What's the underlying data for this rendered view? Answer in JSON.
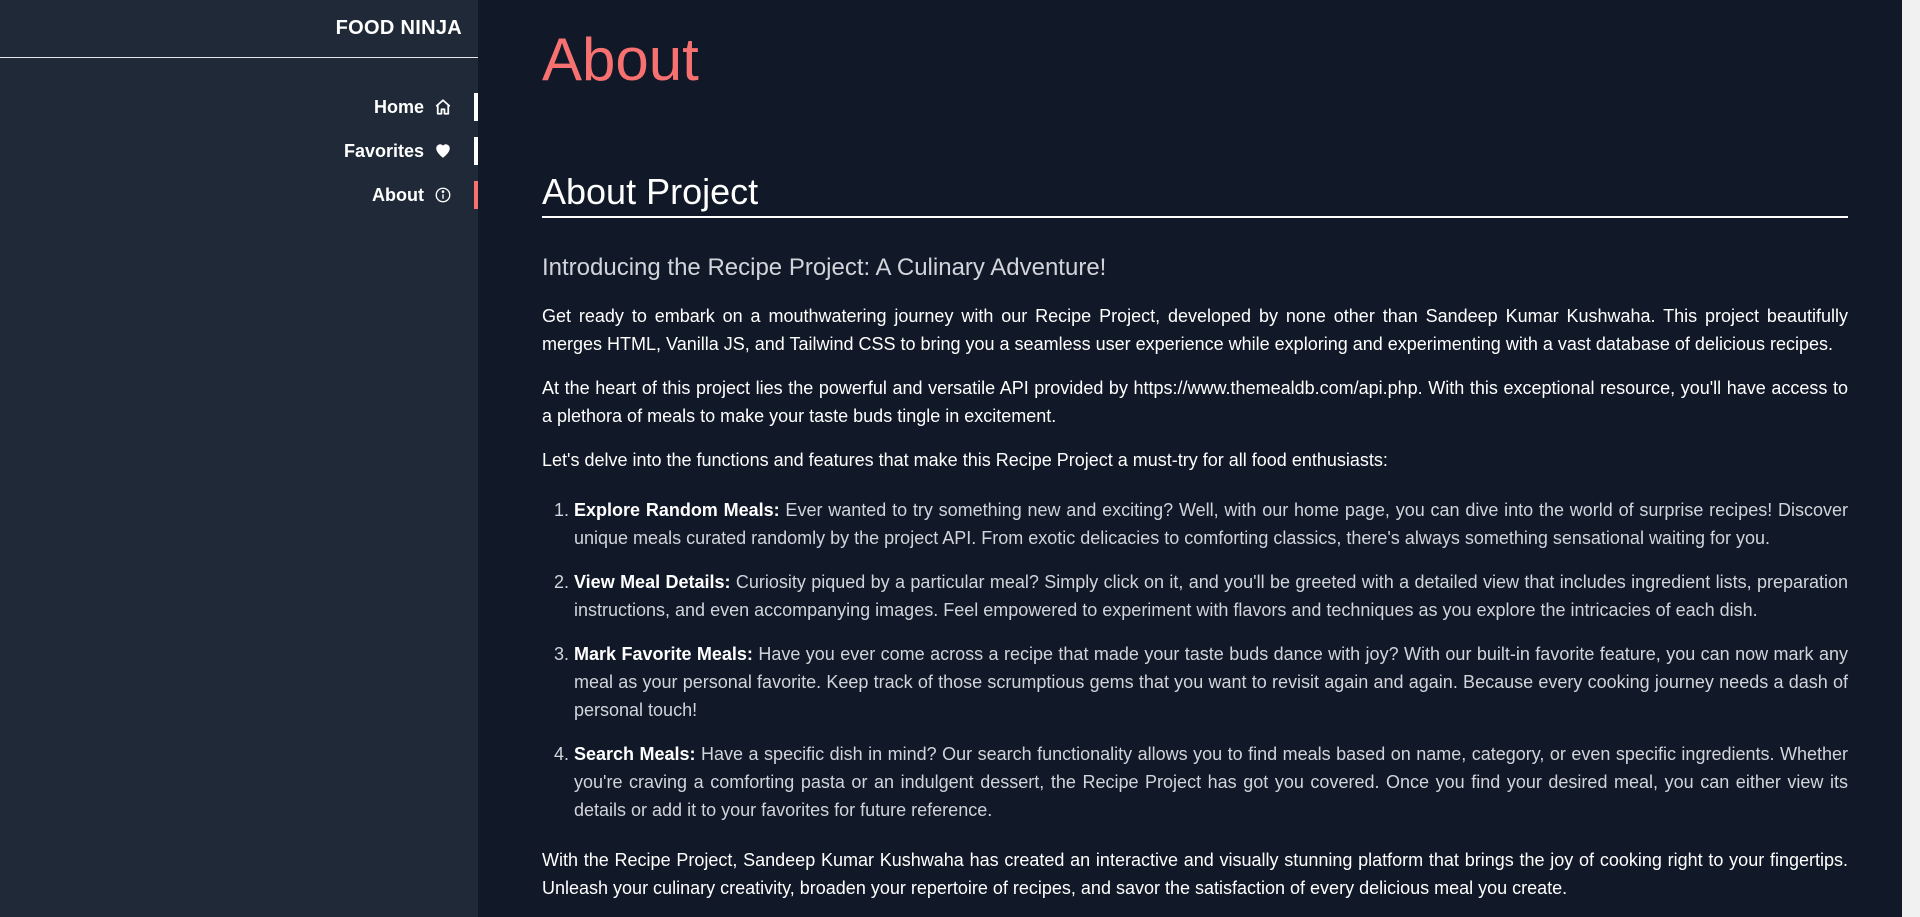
{
  "sidebar": {
    "brand": "FOOD NINJA",
    "items": [
      {
        "label": "Home",
        "icon": "home-icon"
      },
      {
        "label": "Favorites",
        "icon": "heart-icon"
      },
      {
        "label": "About",
        "icon": "info-icon",
        "active": true
      }
    ]
  },
  "colors": {
    "accent": "#f87171",
    "sidebar_bg": "#1f2937",
    "main_bg": "#111827"
  },
  "main": {
    "title": "About",
    "section_title": "About Project",
    "subtitle": "Introducing the Recipe Project: A Culinary Adventure!",
    "paragraphs": [
      "Get ready to embark on a mouthwatering journey with our Recipe Project, developed by none other than Sandeep Kumar Kushwaha. This project beautifully merges HTML, Vanilla JS, and Tailwind CSS to bring you a seamless user experience while exploring and experimenting with a vast database of delicious recipes.",
      "At the heart of this project lies the powerful and versatile API provided by https://www.themealdb.com/api.php. With this exceptional resource, you'll have access to a plethora of meals to make your taste buds tingle in excitement.",
      "Let's delve into the functions and features that make this Recipe Project a must-try for all food enthusiasts:"
    ],
    "features": [
      {
        "term": "Explore Random Meals:",
        "text": " Ever wanted to try something new and exciting? Well, with our home page, you can dive into the world of surprise recipes! Discover unique meals curated randomly by the project API. From exotic delicacies to comforting classics, there's always something sensational waiting for you."
      },
      {
        "term": "View Meal Details:",
        "text": " Curiosity piqued by a particular meal? Simply click on it, and you'll be greeted with a detailed view that includes ingredient lists, preparation instructions, and even accompanying images. Feel empowered to experiment with flavors and techniques as you explore the intricacies of each dish."
      },
      {
        "term": "Mark Favorite Meals:",
        "text": " Have you ever come across a recipe that made your taste buds dance with joy? With our built-in favorite feature, you can now mark any meal as your personal favorite. Keep track of those scrumptious gems that you want to revisit again and again. Because every cooking journey needs a dash of personal touch!"
      },
      {
        "term": "Search Meals:",
        "text": " Have a specific dish in mind? Our search functionality allows you to find meals based on name, category, or even specific ingredients. Whether you're craving a comforting pasta or an indulgent dessert, the Recipe Project has got you covered. Once you find your desired meal, you can either view its details or add it to your favorites for future reference."
      }
    ],
    "closing": "With the Recipe Project, Sandeep Kumar Kushwaha has created an interactive and visually stunning platform that brings the joy of cooking right to your fingertips. Unleash your culinary creativity, broaden your repertoire of recipes, and savor the satisfaction of every delicious meal you create."
  }
}
